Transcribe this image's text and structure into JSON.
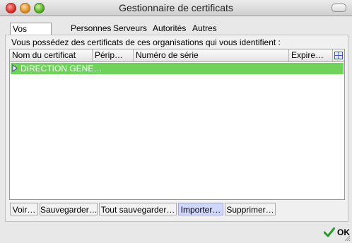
{
  "window": {
    "title": "Gestionnaire de certificats"
  },
  "tabs": [
    {
      "label": "Vos certificats",
      "active": true
    },
    {
      "label": "Personnes"
    },
    {
      "label": "Serveurs"
    },
    {
      "label": "Autorités"
    },
    {
      "label": "Autres"
    }
  ],
  "description": "Vous possédez des certificats de ces organisations qui vous identifient :",
  "table": {
    "columns": [
      "Nom du certificat",
      "Périp…",
      "Numéro de série",
      "Expire…"
    ],
    "rows": [
      {
        "name": "DIRECTION GENE…",
        "expanded": false,
        "selected": true
      }
    ]
  },
  "buttons": {
    "view": "Voir…",
    "backup": "Sauvegarder…",
    "backup_all": "Tout sauvegarder…",
    "import": "Importer…",
    "delete": "Supprimer…"
  },
  "ok": "OK",
  "colors": {
    "selection": "#6fd35a",
    "import_highlight": "#cfd7ff",
    "ok_check": "#2a9a2a"
  }
}
